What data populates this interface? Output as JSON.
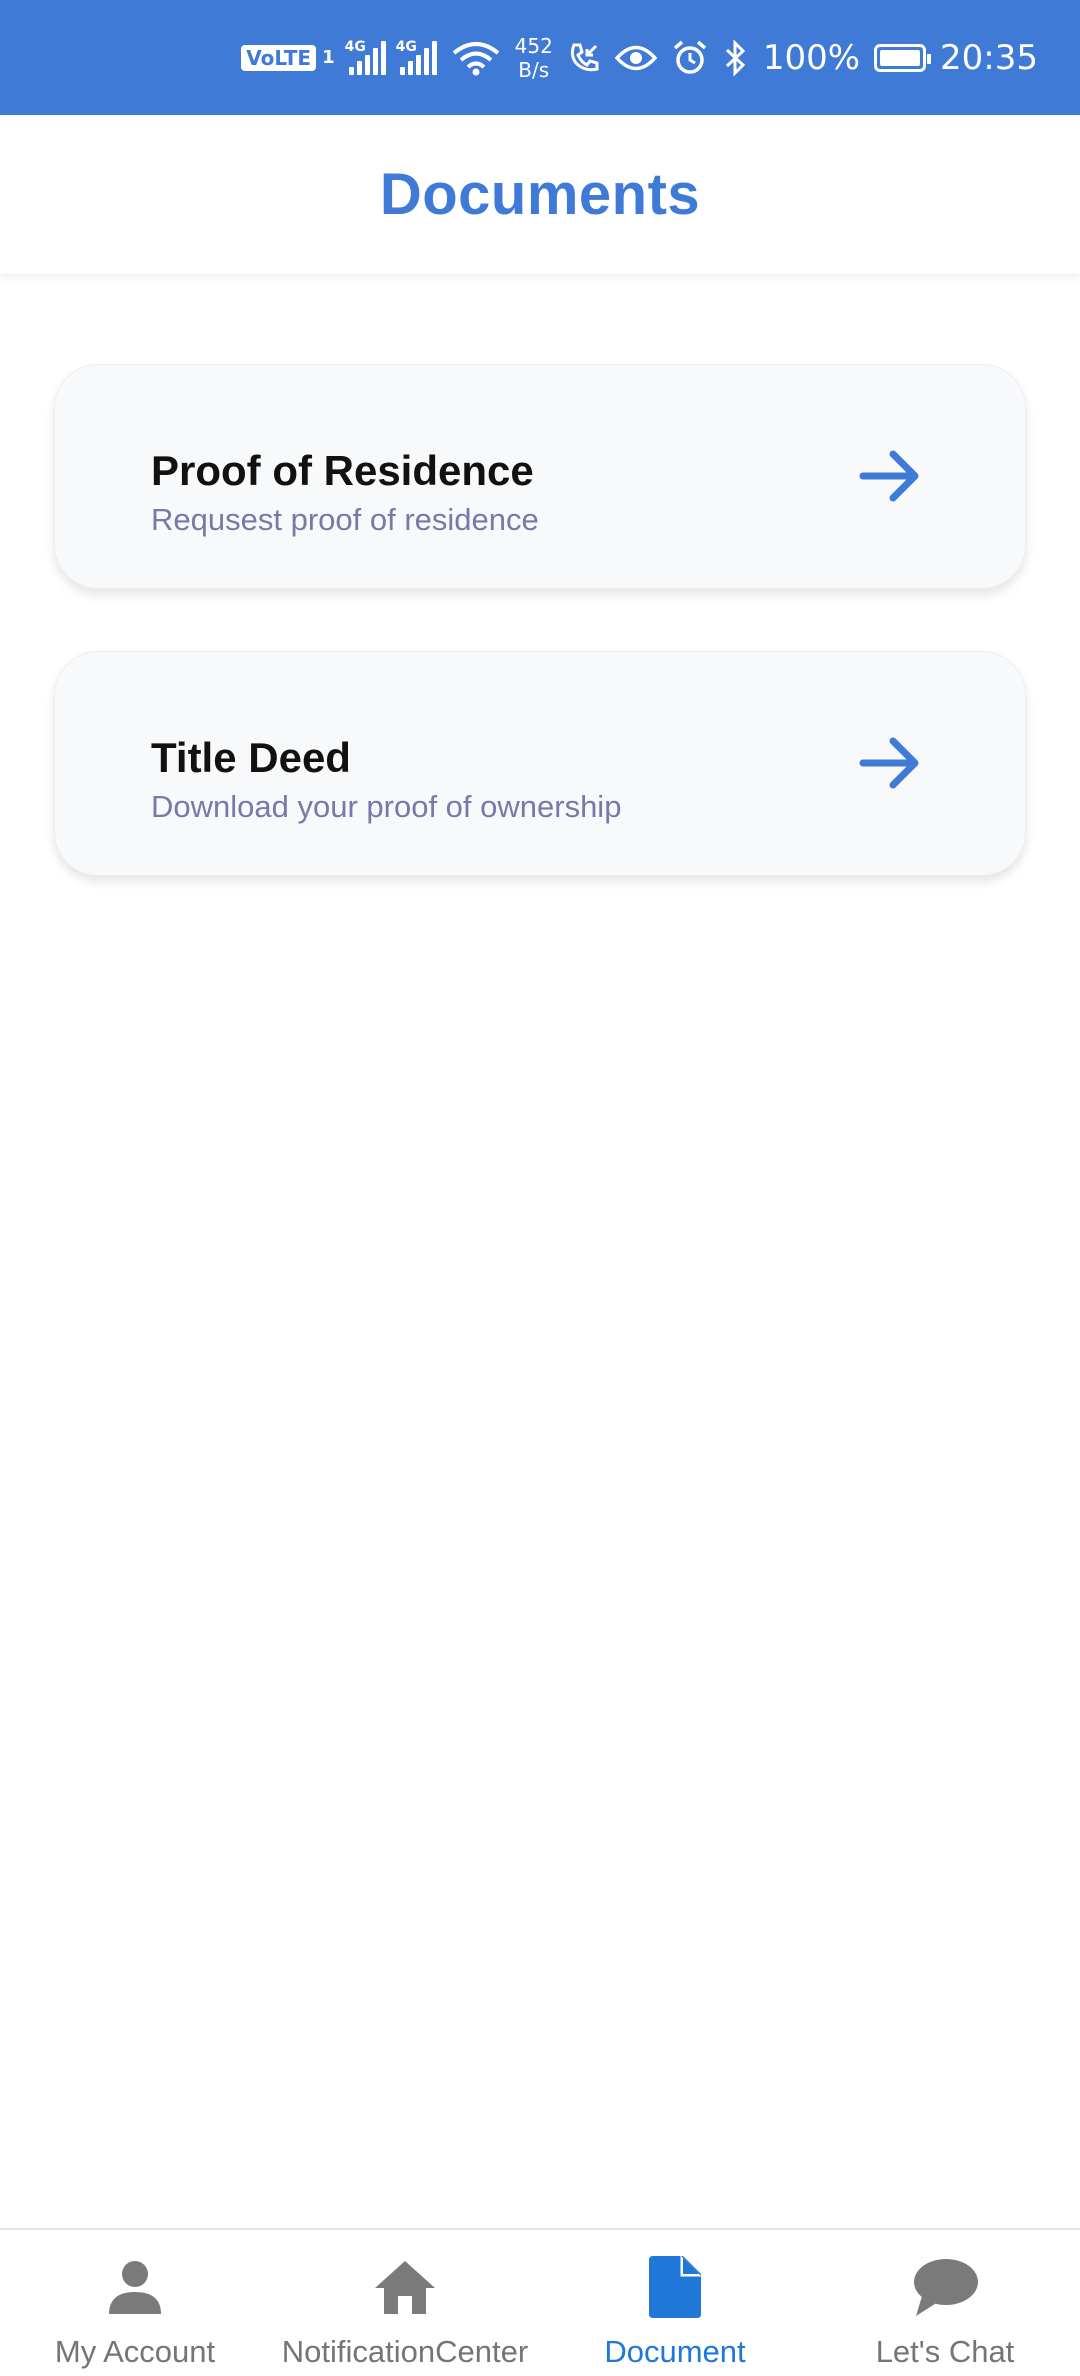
{
  "status_bar": {
    "volte": "VoLTE",
    "sim": "1",
    "network_1": "4G",
    "network_2": "4G",
    "speed_value": "452",
    "speed_unit": "B/s",
    "battery": "100%",
    "time": "20:35",
    "icons": [
      "volte-icon",
      "signal-icon",
      "signal-icon",
      "wifi-icon",
      "call-icon",
      "eye-icon",
      "alarm-icon",
      "bluetooth-icon",
      "battery-icon"
    ]
  },
  "header": {
    "title": "Documents"
  },
  "documents": [
    {
      "title": "Proof of Residence",
      "subtitle": "Requsest proof of residence",
      "icon": "arrow-right-icon"
    },
    {
      "title": "Title Deed",
      "subtitle": "Download your proof of ownership",
      "icon": "arrow-right-icon"
    }
  ],
  "bottom_nav": {
    "items": [
      {
        "label": "My Account",
        "icon": "person-icon",
        "active": false
      },
      {
        "label": "NotificationCenter",
        "icon": "home-icon",
        "active": false
      },
      {
        "label": "Document",
        "icon": "document-icon",
        "active": true
      },
      {
        "label": "Let's Chat",
        "icon": "chat-bubble-icon",
        "active": false
      }
    ]
  },
  "colors": {
    "primary": "#3f7ad6",
    "nav_active": "#1f77d8",
    "nav_inactive": "#757575",
    "subtitle": "#7a78a8",
    "card_bg": "#f7f9fb"
  }
}
